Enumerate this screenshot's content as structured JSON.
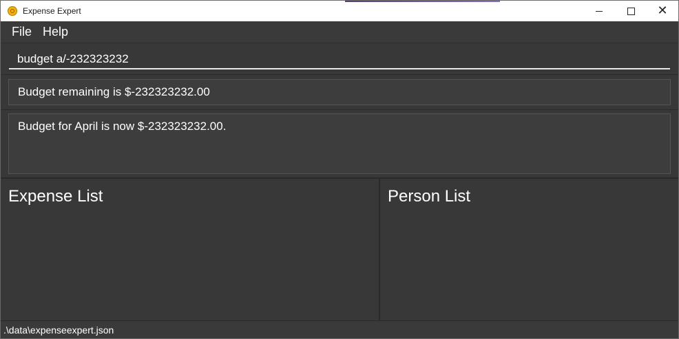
{
  "window": {
    "title": "Expense Expert"
  },
  "menu": {
    "items": [
      "File",
      "Help"
    ]
  },
  "command": {
    "value": "budget a/-232323232"
  },
  "budget": {
    "text": "Budget remaining is $-232323232.00"
  },
  "result": {
    "text": "Budget for April is now $-232323232.00."
  },
  "panels": {
    "expense_title": "Expense List",
    "person_title": "Person List"
  },
  "status": {
    "path": ".\\data\\expenseexpert.json"
  },
  "colors": {
    "background": "#3b3b3b",
    "text": "#ffffff",
    "titlebar": "#ffffff"
  }
}
